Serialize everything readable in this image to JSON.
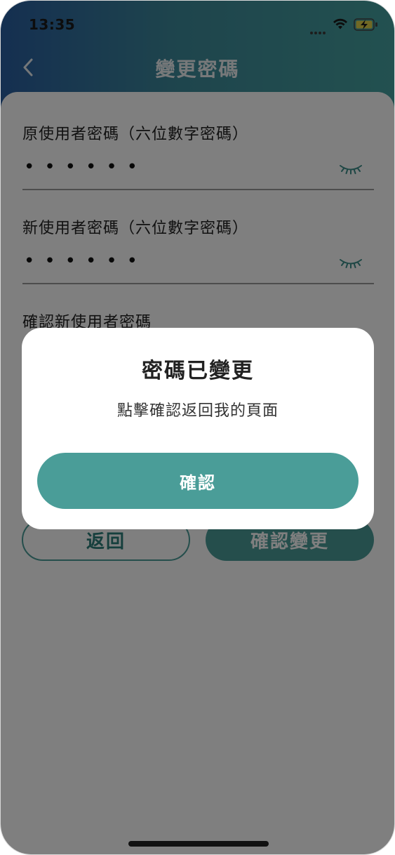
{
  "status_bar": {
    "time": "13:35"
  },
  "nav": {
    "title": "變更密碼",
    "back_icon": "chevron-left-icon"
  },
  "form": {
    "fields": [
      {
        "label": "原使用者密碼（六位數字密碼）",
        "value": "••••••",
        "icon": "eye-closed-icon"
      },
      {
        "label": "新使用者密碼（六位數字密碼）",
        "value": "••••••",
        "icon": "eye-closed-icon"
      },
      {
        "label": "確認新使用者密碼",
        "value": ""
      }
    ],
    "back_label": "返回",
    "confirm_change_label": "確認變更"
  },
  "dialog": {
    "title": "密碼已變更",
    "message": "點擊確認返回我的頁面",
    "confirm_label": "確認"
  },
  "colors": {
    "accent": "#4a9d98",
    "header_gradient_start": "#2a5fa2",
    "header_gradient_end": "#46a2a0",
    "overlay": "rgba(0,0,0,0.5)"
  }
}
